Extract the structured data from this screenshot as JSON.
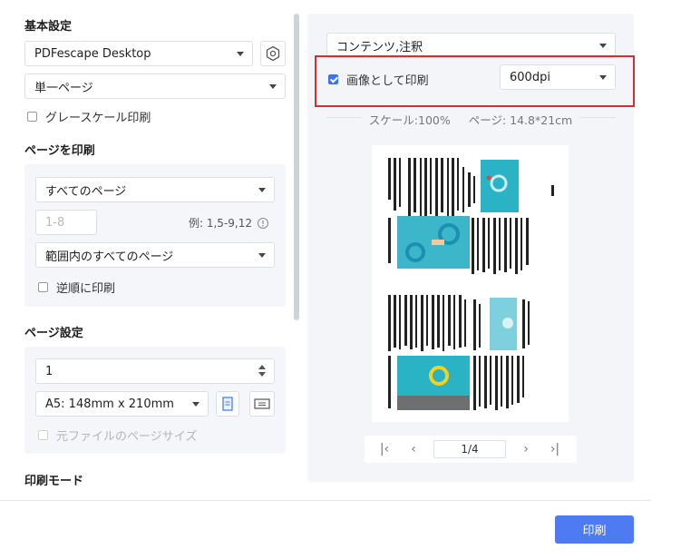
{
  "left": {
    "basic": {
      "title": "基本設定",
      "printer": "PDFescape Desktop",
      "page_mode": "単一ページ",
      "grayscale_label": "グレースケール印刷"
    },
    "print_pages": {
      "title": "ページを印刷",
      "range_select": "すべてのページ",
      "range_placeholder": "1-8",
      "example": "例: 1,5-9,12",
      "subset_select": "範囲内のすべてのページ",
      "reverse_label": "逆順に印刷"
    },
    "page_setup": {
      "title": "ページ設定",
      "copies": "1",
      "paper": "A5: 148mm x 210mm",
      "original_size_label": "元ファイルのページサイズ"
    },
    "print_mode_title": "印刷モード"
  },
  "right": {
    "content_select": "コンテンツ,注釈",
    "print_as_image_label": "画像として印刷",
    "dpi": "600dpi",
    "scale_info": "スケール:100%",
    "page_info": "ページ: 14.8*21cm",
    "page_counter": "1/4"
  },
  "print_button": "印刷",
  "colors": {
    "accent": "#3b73f2",
    "highlight": "#d0302f",
    "pool": "#2ab3c4"
  },
  "icons": [
    "settings-icon",
    "portrait-icon",
    "landscape-icon",
    "info-icon",
    "first-page-icon",
    "prev-page-icon",
    "next-page-icon",
    "last-page-icon"
  ]
}
